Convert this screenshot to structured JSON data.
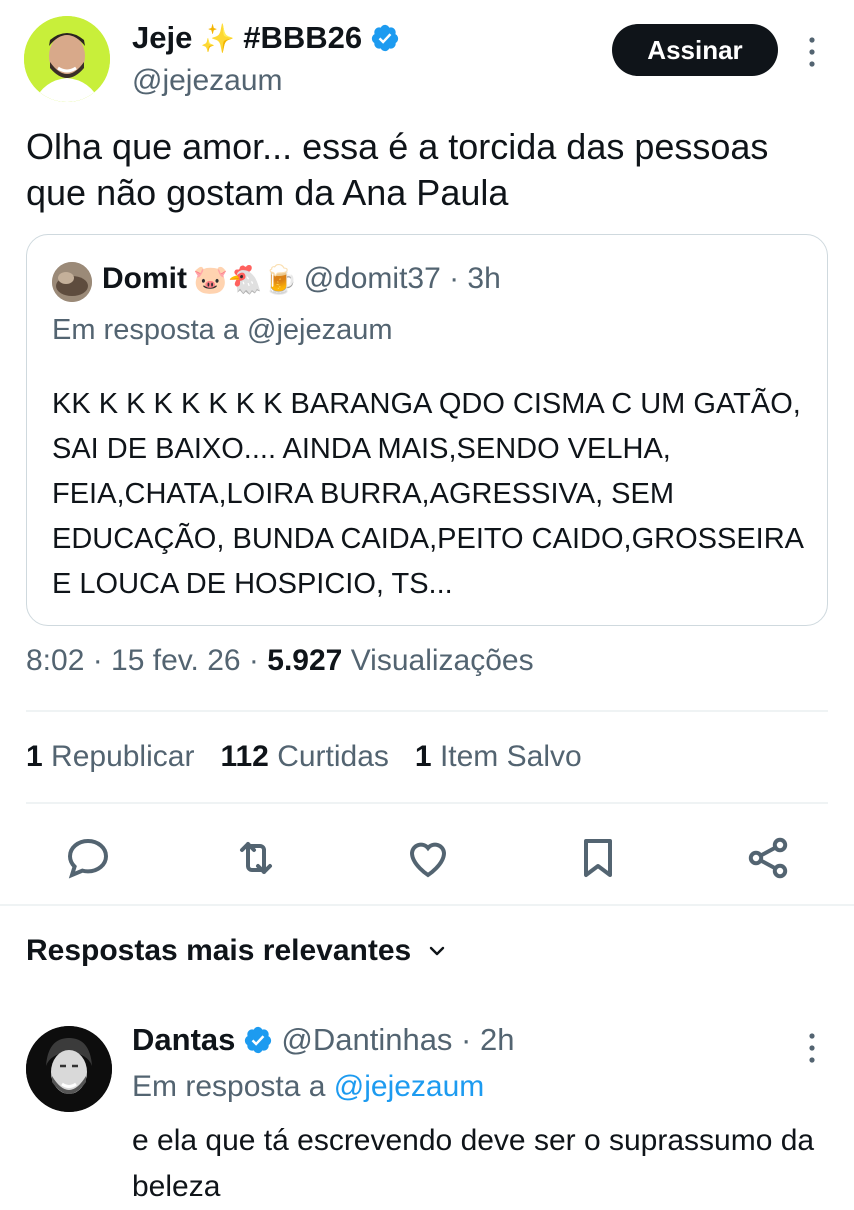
{
  "author": {
    "name": "Jeje",
    "name_emoji": "✨",
    "name_tag": "#BBB26",
    "handle": "@jejezaum",
    "verified": true
  },
  "follow_label": "Assinar",
  "tweet": {
    "text": "Olha que amor... essa é a torcida das pessoas que não gostam da Ana Paula",
    "time": "8:02 · 15 fev. 26 ·",
    "views_count": "5.927",
    "views_label": "Visualizações"
  },
  "quote": {
    "name": "Domit",
    "name_emojis": "🐷🐔🍺",
    "handle_time": "@domit37 · 3h",
    "reply_to": "Em resposta a @jejezaum",
    "text": "KK K K K K K K K BARANGA QDO CISMA C UM GATÃO, SAI DE BAIXO.... AINDA MAIS,SENDO VELHA, FEIA,CHATA,LOIRA BURRA,AGRESSIVA, SEM EDUCAÇÃO, BUNDA CAIDA,PEITO CAIDO,GROSSEIRA E LOUCA DE HOSPICIO, TS..."
  },
  "stats": {
    "reposts_count": "1",
    "reposts_label": "Republicar",
    "likes_count": "112",
    "likes_label": "Curtidas",
    "saves_count": "1",
    "saves_label": "Item Salvo"
  },
  "actions": [
    "reply-icon",
    "repost-icon",
    "like-icon",
    "bookmark-icon",
    "share-icon"
  ],
  "replies_header": "Respostas mais relevantes",
  "reply": {
    "name": "Dantas",
    "handle_time": "@Dantinhas · 2h",
    "reply_prefix": "Em resposta a",
    "reply_to": "@jejezaum",
    "text": "e ela que tá escrevendo deve ser o suprassumo da beleza",
    "verified": true
  },
  "colors": {
    "text": "#0f1419",
    "secondary": "#536471",
    "link": "#1d9bf0",
    "verified": "#1d9bf0",
    "avatar_bg": "#c8ef3a"
  }
}
